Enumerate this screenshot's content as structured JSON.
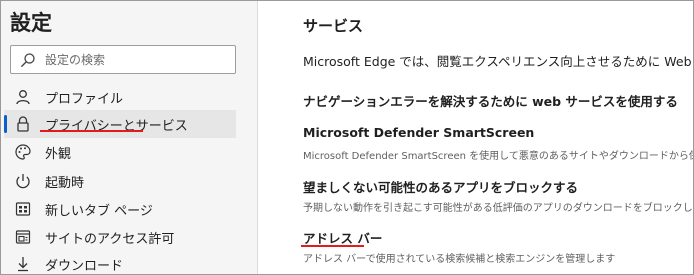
{
  "sidebar": {
    "title": "設定",
    "search": {
      "placeholder": "設定の検索"
    },
    "items": [
      {
        "label": "プロファイル",
        "icon": "profile-icon"
      },
      {
        "label": "プライバシーとサービス",
        "icon": "lock-icon",
        "active": true
      },
      {
        "label": "外観",
        "icon": "palette-icon"
      },
      {
        "label": "起動時",
        "icon": "power-icon"
      },
      {
        "label": "新しいタブ ページ",
        "icon": "new-tab-icon"
      },
      {
        "label": "サイトのアクセス許可",
        "icon": "site-permissions-icon"
      },
      {
        "label": "ダウンロード",
        "icon": "download-icon"
      }
    ]
  },
  "main": {
    "section_title": "サービス",
    "intro": "Microsoft Edge では、閲覧エクスペリエンス向上させるために Web サービスを使用",
    "settings": [
      {
        "title": "ナビゲーションエラーを解決するために web サービスを使用する",
        "description": ""
      },
      {
        "title": "Microsoft Defender SmartScreen",
        "description": "Microsoft Defender SmartScreen を使用して悪意のあるサイトやダウンロードから保護します。"
      },
      {
        "title": "望ましくない可能性のあるアプリをブロックする",
        "description": "予期しない動作を引き起こす可能性がある低評価のアプリのダウンロードをブロックします。"
      },
      {
        "title": "アドレス バー",
        "description": "アドレス バーで使用されている検索候補と検索エンジンを管理します"
      }
    ]
  },
  "colors": {
    "accent": "#0a60c8",
    "annotation_red": "#e11c1c",
    "sidebar_bg": "#f5f5f5",
    "active_bg": "#e6e6e6"
  }
}
